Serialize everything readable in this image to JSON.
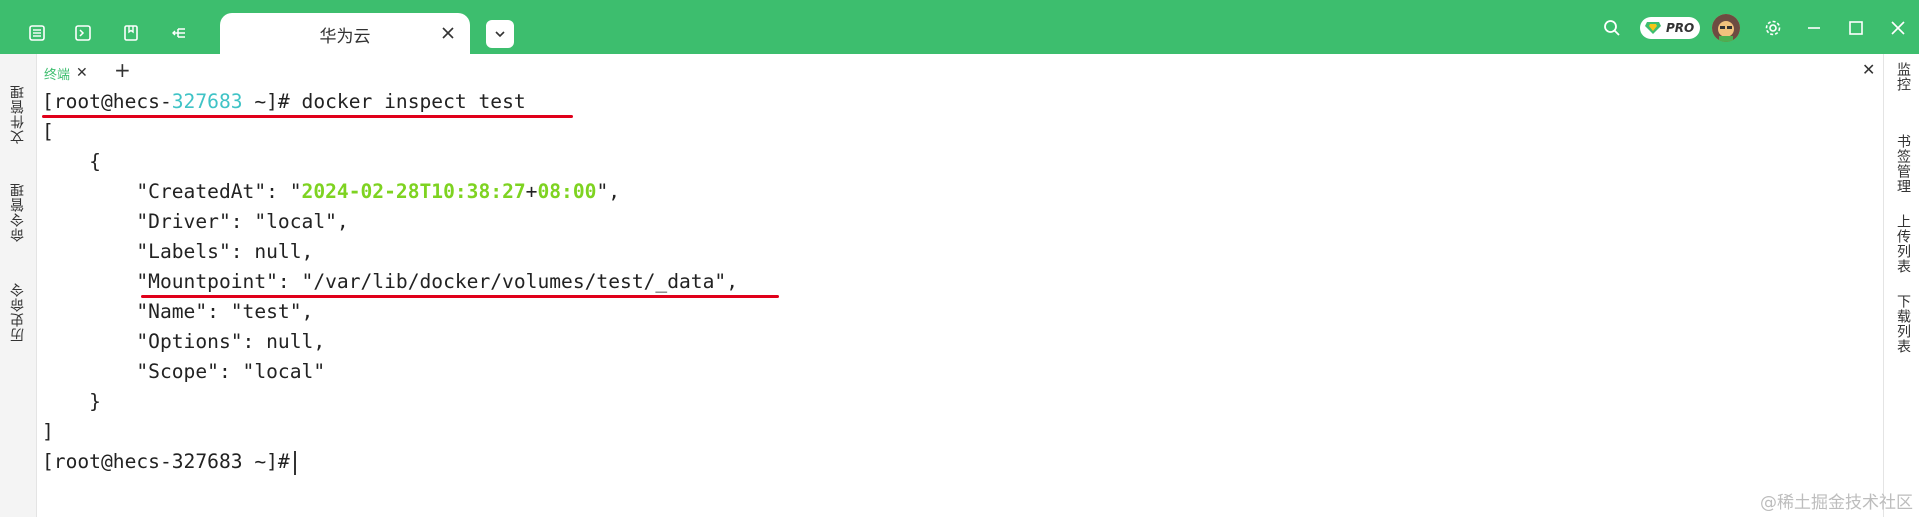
{
  "tab": {
    "title": "华为云"
  },
  "terminal_tab": {
    "label": "终端"
  },
  "left_sidebar": {
    "items": [
      {
        "label": "文件管理"
      },
      {
        "label": "命令管理"
      },
      {
        "label": "历史命令"
      }
    ]
  },
  "right_sidebar": {
    "items": [
      {
        "label": "监控"
      },
      {
        "label": "书签管理"
      },
      {
        "label": "上传列表"
      },
      {
        "label": "下载列表"
      }
    ]
  },
  "badge": {
    "pro": "PRO"
  },
  "terminal": {
    "prompt_pre": "[root@hecs-",
    "prompt_num": "327683",
    "prompt_post": " ~]# ",
    "command": "docker inspect test",
    "open_bracket": "[",
    "open_brace": "    {",
    "created_key": "        \"CreatedAt\": \"",
    "created_date": "2024-02-28T10:38:27",
    "created_plus": "+",
    "created_tz": "08:00",
    "created_end": "\",",
    "driver": "        \"Driver\": \"local\",",
    "labels": "        \"Labels\": null,",
    "mountpoint": "        \"Mountpoint\": \"/var/lib/docker/volumes/test/_data\",",
    "name": "        \"Name\": \"test\",",
    "options": "        \"Options\": null,",
    "scope": "        \"Scope\": \"local\"",
    "close_brace": "    }",
    "close_bracket": "]",
    "final_prompt": "[root@hecs-327683 ~]#"
  },
  "watermark": "@稀土掘金技术社区",
  "colors": {
    "topbar": "#3dbe6e",
    "accent_cyan": "#3fc3c6",
    "accent_green": "#7ed321",
    "underline_red": "#e0001a"
  }
}
